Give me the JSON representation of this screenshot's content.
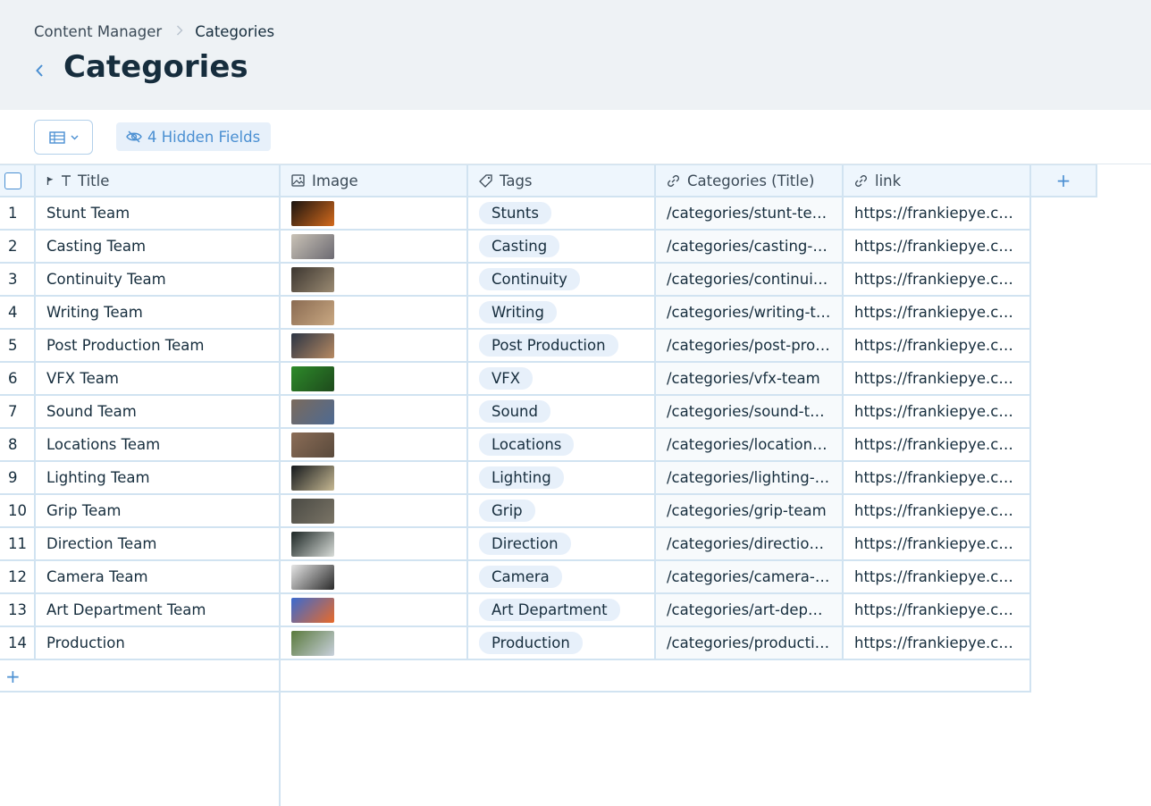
{
  "breadcrumb": {
    "parent": "Content Manager",
    "current": "Categories"
  },
  "page": {
    "title": "Categories"
  },
  "toolbar": {
    "hidden_fields_label": "4 Hidden Fields"
  },
  "columns": {
    "title": "Title",
    "image": "Image",
    "tags": "Tags",
    "categories": "Categories (Title)",
    "link": "link"
  },
  "rows": [
    {
      "num": "1",
      "title": "Stunt Team",
      "tag": "Stunts",
      "cat": "/categories/stunt-team",
      "link": "https://frankiepye.com",
      "thumb": [
        "#1a1410",
        "#d46a1c"
      ]
    },
    {
      "num": "2",
      "title": "Casting Team",
      "tag": "Casting",
      "cat": "/categories/casting-team",
      "link": "https://frankiepye.com",
      "thumb": [
        "#c9c2b6",
        "#6c6a72"
      ]
    },
    {
      "num": "3",
      "title": "Continuity Team",
      "tag": "Continuity",
      "cat": "/categories/continuity-team",
      "link": "https://frankiepye.com",
      "thumb": [
        "#3c3630",
        "#9a8a72"
      ]
    },
    {
      "num": "4",
      "title": "Writing Team",
      "tag": "Writing",
      "cat": "/categories/writing-team",
      "link": "https://frankiepye.com",
      "thumb": [
        "#8a6b52",
        "#c9a882"
      ]
    },
    {
      "num": "5",
      "title": "Post Production Team",
      "tag": "Post Production",
      "cat": "/categories/post-production-team",
      "link": "https://frankiepye.com",
      "thumb": [
        "#2b3444",
        "#b78a62"
      ]
    },
    {
      "num": "6",
      "title": "VFX Team",
      "tag": "VFX",
      "cat": "/categories/vfx-team",
      "link": "https://frankiepye.com",
      "thumb": [
        "#2d8a2a",
        "#1e4a1c"
      ]
    },
    {
      "num": "7",
      "title": "Sound Team",
      "tag": "Sound",
      "cat": "/categories/sound-team",
      "link": "https://frankiepye.com",
      "thumb": [
        "#7a6a5c",
        "#4e6a92"
      ]
    },
    {
      "num": "8",
      "title": "Locations Team",
      "tag": "Locations",
      "cat": "/categories/locations-team",
      "link": "https://frankiepye.com",
      "thumb": [
        "#8a6c56",
        "#5a4a3c"
      ]
    },
    {
      "num": "9",
      "title": "Lighting Team",
      "tag": "Lighting",
      "cat": "/categories/lighting-team",
      "link": "https://frankiepye.com",
      "thumb": [
        "#14181c",
        "#c6b892"
      ]
    },
    {
      "num": "10",
      "title": "Grip Team",
      "tag": "Grip",
      "cat": "/categories/grip-team",
      "link": "https://frankiepye.com",
      "thumb": [
        "#4a4a44",
        "#7a7466"
      ]
    },
    {
      "num": "11",
      "title": "Direction Team",
      "tag": "Direction",
      "cat": "/categories/direction-team",
      "link": "https://frankiepye.com",
      "thumb": [
        "#1c2624",
        "#d8dcd8"
      ]
    },
    {
      "num": "12",
      "title": "Camera Team",
      "tag": "Camera",
      "cat": "/categories/camera-team",
      "link": "https://frankiepye.com",
      "thumb": [
        "#e6e6e6",
        "#2a2a2a"
      ]
    },
    {
      "num": "13",
      "title": "Art Department Team",
      "tag": "Art Department",
      "cat": "/categories/art-department-team",
      "link": "https://frankiepye.com",
      "thumb": [
        "#3a6ad0",
        "#e86a2a"
      ]
    },
    {
      "num": "14",
      "title": "Production",
      "tag": "Production",
      "cat": "/categories/production",
      "link": "https://frankiepye.com",
      "thumb": [
        "#5a7a3c",
        "#c8d0dc"
      ]
    }
  ]
}
